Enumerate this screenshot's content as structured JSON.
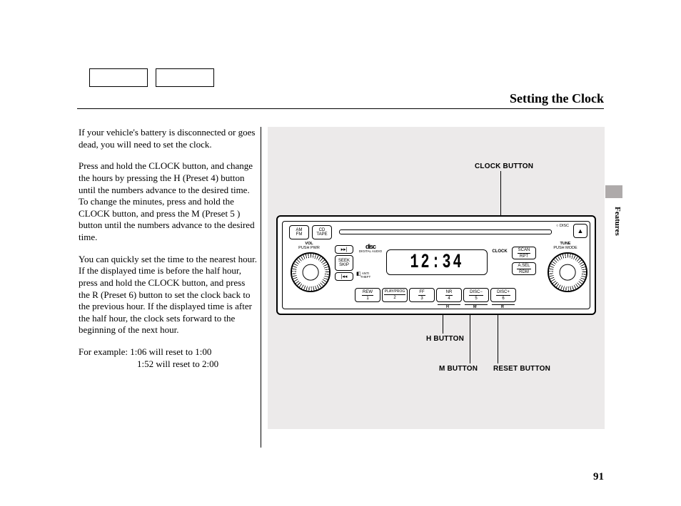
{
  "title": "Setting the Clock",
  "side_tab": "Features",
  "page_number": "91",
  "paragraphs": {
    "p1": "If your vehicle's battery is disconnected or goes dead, you will need to set the clock.",
    "p2": "Press and hold the CLOCK button, and change the hours by pressing the H (Preset 4) button until the numbers advance to the desired time. To change the minutes, press and hold the CLOCK button, and press the M (Preset 5 ) button until the numbers advance to the desired time.",
    "p3": "You can quickly set the time to the nearest hour. If the displayed time is before the half hour, press and hold the CLOCK button, and press the R (Preset 6) button to set the clock back to the previous hour. If the displayed time is after the half hour, the clock sets forward to the beginning of the next hour.",
    "example_lead": "For example:",
    "example_l1": "1:06 will reset to 1:00",
    "example_l2": "1:52 will reset to 2:00"
  },
  "callouts": {
    "clock": "CLOCK BUTTON",
    "h": "H BUTTON",
    "m": "M BUTTON",
    "reset": "RESET BUTTON"
  },
  "radio": {
    "time": "12:34",
    "clock_label": "CLOCK",
    "am_fm": "AM\nFM",
    "cd_tape": "CD\nTAPE",
    "disc_label": "DISC",
    "eject_glyph": "▲",
    "tune": "TUNE",
    "tune_sub": "PUSH MODE",
    "scan": "SCAN",
    "scan_sub": "RPT",
    "asel": "A.SEL",
    "asel_sub": "RDM",
    "seek": "SEEK",
    "seek_sub": "SKIP",
    "vol": "VOL",
    "vol_sub": "PUSH PWR",
    "cd_logo": "DIGITAL AUDIO",
    "anti_theft": "ANTI\nTHEFT",
    "presets": {
      "p1_top": "REW",
      "p1_bot": "1",
      "p2_top": "PLAY/PROG",
      "p2_bot": "2",
      "p3_top": "FF",
      "p3_bot": "3",
      "p4_top": "NR",
      "p4_bot": "4",
      "p5_top": "DISC−",
      "p5_bot": "5",
      "p6_top": "DISC+",
      "p6_bot": "6"
    },
    "sub_h": "H",
    "sub_m": "M",
    "sub_r": "R"
  }
}
